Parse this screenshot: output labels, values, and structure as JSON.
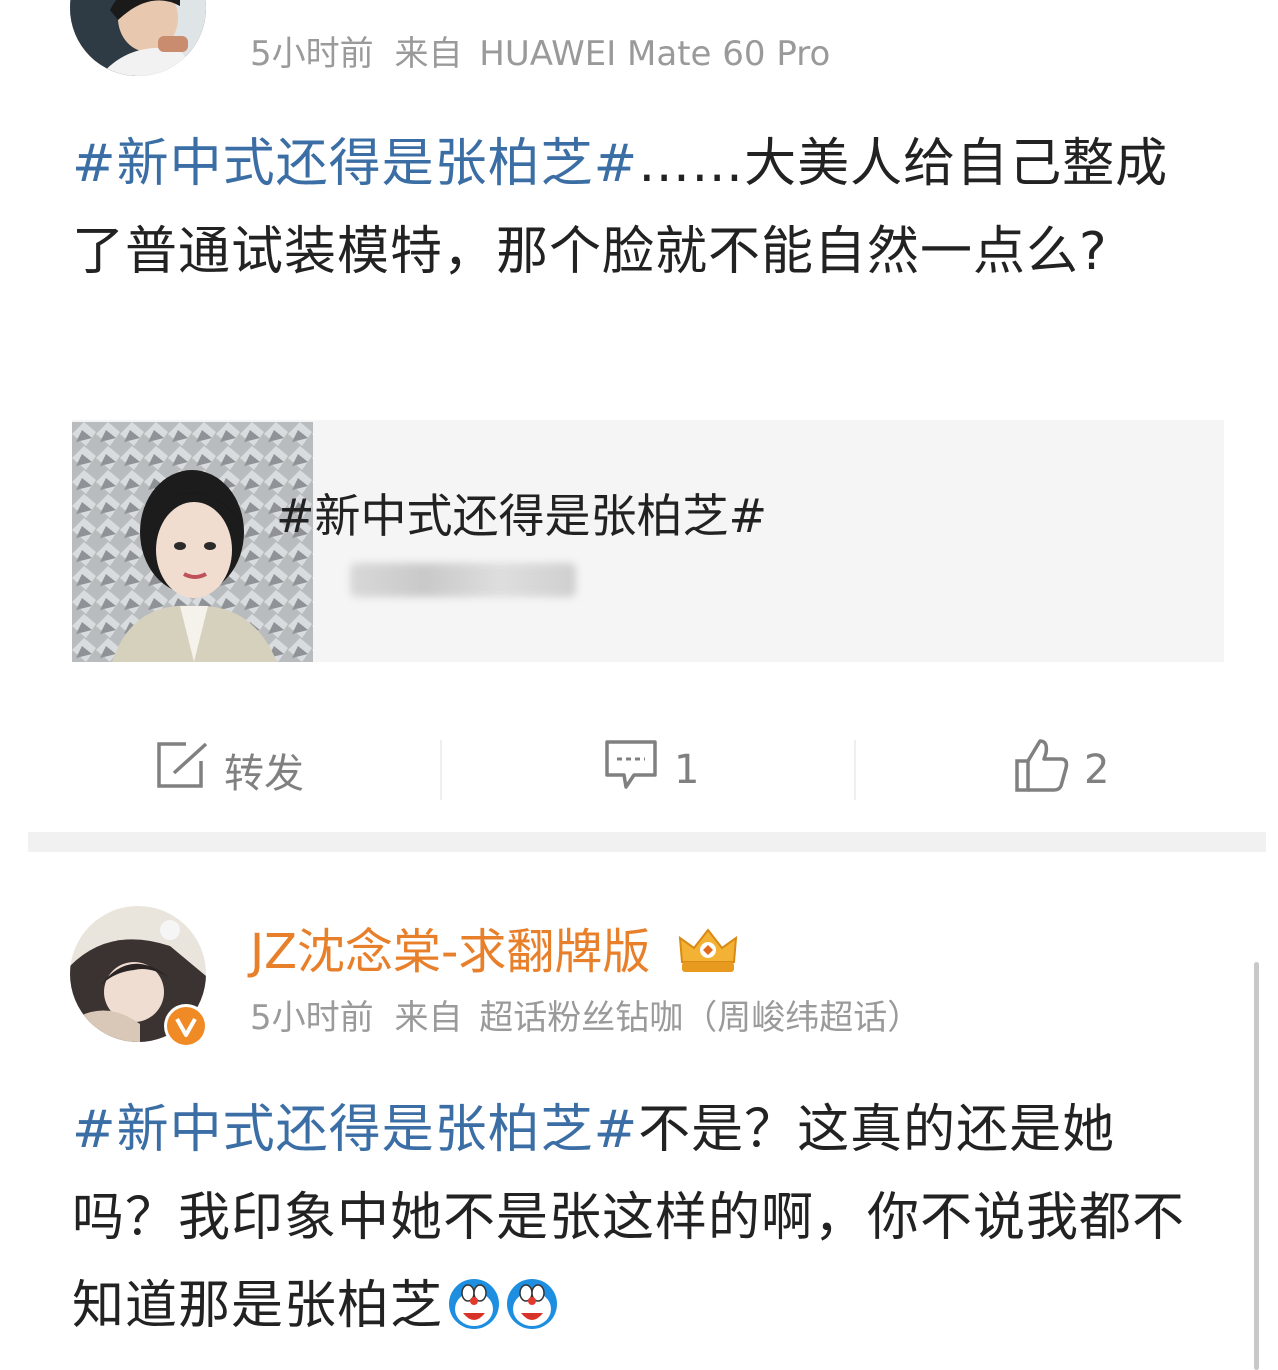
{
  "post1": {
    "time": "5小时前",
    "source_prefix": "来自",
    "device": "HUAWEI Mate 60 Pro",
    "hashtag": "#新中式还得是张柏芝#",
    "body": "……大美人给自己整成了普通试装模特，那个脸就不能自然一点么?",
    "card": {
      "title": "#新中式还得是张柏芝#"
    },
    "actions": {
      "repost_label": "转发",
      "comment_count": "1",
      "like_count": "2"
    }
  },
  "post2": {
    "username": "JZ沈念棠-求翻牌版",
    "time": "5小时前",
    "source_prefix": "来自",
    "source": "超话粉丝钻咖（周峻纬超话）",
    "hashtag": "#新中式还得是张柏芝#",
    "body": "不是？这真的还是她吗？我印象中她不是张这样的啊，你不说我都不知道那是张柏芝"
  },
  "colors": {
    "hashtag": "#3b6ea5",
    "username": "#e8802b",
    "meta": "#9a9a9a",
    "verified_badge": "#f08a24"
  }
}
